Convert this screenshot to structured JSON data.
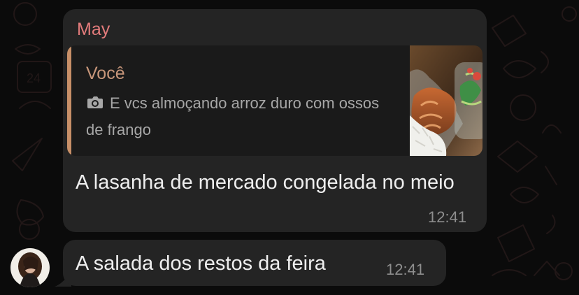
{
  "conversation": {
    "sender_name": "May",
    "messages": [
      {
        "quoted": {
          "author": "Você",
          "media_icon": "camera-icon",
          "text": "E vcs almoçando arroz duro com ossos de frango"
        },
        "text": "A lasanha de mercado congelada no meio",
        "time": "12:41"
      },
      {
        "text": "A salada dos restos da feira",
        "time": "12:41"
      }
    ]
  },
  "colors": {
    "background": "#0b0b0b",
    "bubble": "#242424",
    "sender_name": "#e27b7b",
    "quote_accent": "#c89068",
    "quote_author": "#c7967a",
    "quote_text": "#a7a7a7",
    "timestamp": "#8e8e8e"
  }
}
